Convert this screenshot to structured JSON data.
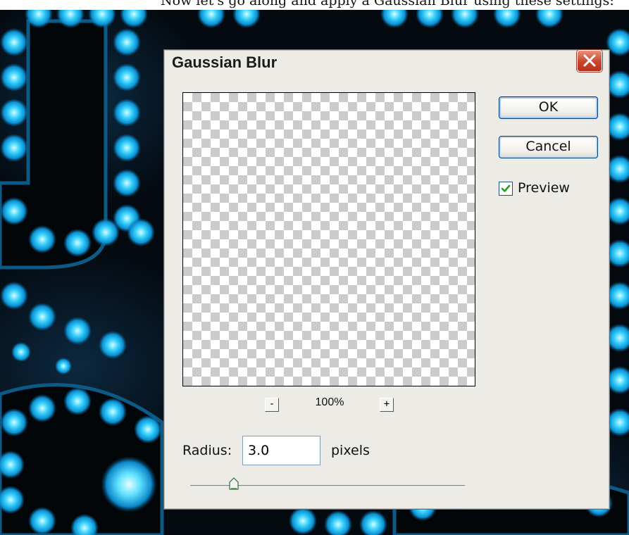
{
  "page": {
    "top_caption": "Now let's go along and apply a Gaussian Blur using these settings:"
  },
  "dialog": {
    "title": "Gaussian Blur",
    "close_icon": "close-x-icon",
    "buttons": {
      "ok": "OK",
      "cancel": "Cancel"
    },
    "preview": {
      "label": "Preview",
      "checked": true
    },
    "zoom": {
      "minus": "-",
      "level": "100%",
      "plus": "+"
    },
    "radius": {
      "label": "Radius:",
      "value": "3.0",
      "unit": "pixels"
    },
    "slider": {
      "value_fraction": 0.16
    },
    "colors": {
      "dialog_bg": "#ecebe6",
      "close_button": "#c8452c",
      "checkmark": "#21a121",
      "background_glow": "#1fd0ff"
    }
  }
}
